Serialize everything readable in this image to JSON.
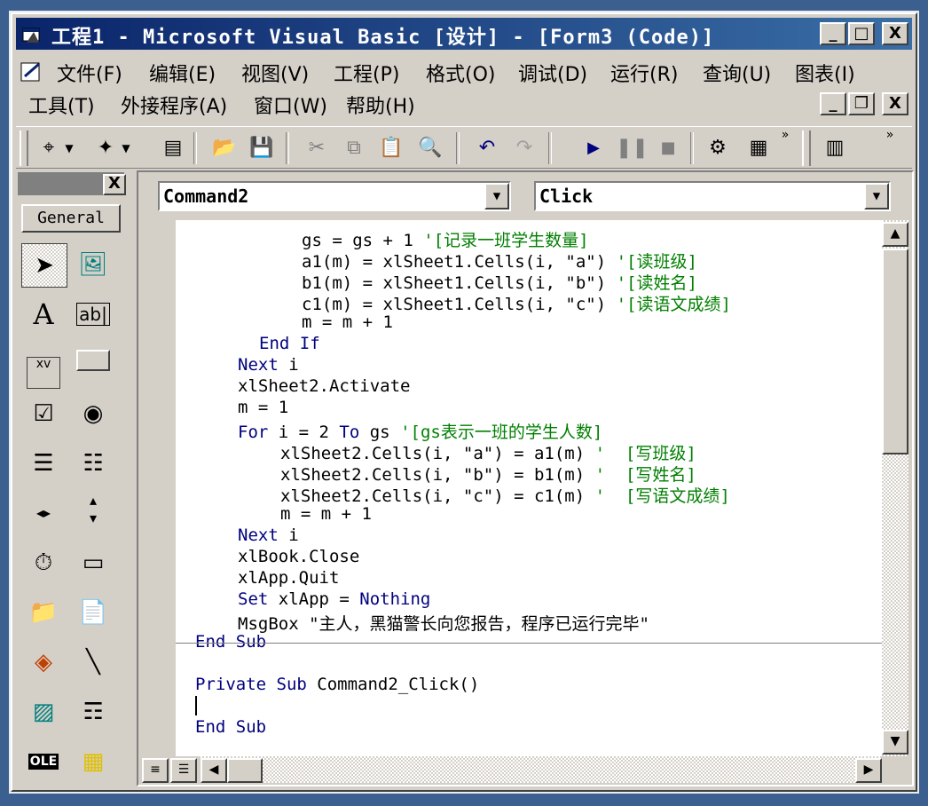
{
  "window": {
    "title": "工程1 - Microsoft Visual Basic [设计] - [Form3 (Code)]"
  },
  "window_buttons": {
    "minimize": "_",
    "maximize": "□",
    "close": "X"
  },
  "menu": [
    {
      "label": "文件(F)"
    },
    {
      "label": "编辑(E)"
    },
    {
      "label": "视图(V)"
    },
    {
      "label": "工程(P)"
    },
    {
      "label": "格式(O)"
    },
    {
      "label": "调试(D)"
    },
    {
      "label": "运行(R)"
    },
    {
      "label": "查询(U)"
    },
    {
      "label": "图表(I)"
    },
    {
      "label": "工具(T)"
    },
    {
      "label": "外接程序(A)"
    },
    {
      "label": "窗口(W)"
    },
    {
      "label": "帮助(H)"
    }
  ],
  "toolbox": {
    "tab_label": "General",
    "close": "X"
  },
  "code_window": {
    "object_combo": "Command2",
    "procedure_combo": "Click"
  },
  "code_lines": [
    {
      "text": "gs = gs + 1",
      "comment": "'[记录一班学生数量]"
    },
    {
      "text": "a1(m) = xlSheet1.Cells(i, \"a\")",
      "comment": "'[读班级]"
    },
    {
      "text": "b1(m) = xlSheet1.Cells(i, \"b\")",
      "comment": "'[读姓名]"
    },
    {
      "text": "c1(m) = xlSheet1.Cells(i, \"c\")",
      "comment": "'[读语文成绩]"
    },
    {
      "text": "m = m + 1",
      "comment": ""
    },
    {
      "kw": "End If"
    },
    {
      "kw": "Next",
      "text": " i"
    },
    {
      "text": "xlSheet2.Activate"
    },
    {
      "text": "m = 1"
    },
    {
      "kw": "For",
      "text": " i = 2 ",
      "kw2": "To",
      "text2": " gs ",
      "comment": "'[gs表示一班的学生人数]"
    },
    {
      "text": "xlSheet2.Cells(i, \"a\") = a1(m)",
      "comment": "'  [写班级]"
    },
    {
      "text": "xlSheet2.Cells(i, \"b\") = b1(m)",
      "comment": "'  [写姓名]"
    },
    {
      "text": "xlSheet2.Cells(i, \"c\") = c1(m)",
      "comment": "'  [写语文成绩]"
    },
    {
      "text": "m = m + 1"
    },
    {
      "kw": "Next",
      "text": " i"
    },
    {
      "text": "xlBook.Close"
    },
    {
      "text": "xlApp.Quit"
    },
    {
      "kw": "Set",
      "text": " xlApp = ",
      "kw2": "Nothing"
    },
    {
      "text": "MsgBox \"主人，黑猫警长向您报告，程序已运行完毕\""
    },
    {
      "kw": "End Sub"
    },
    {
      "kw": "Private Sub",
      "text": " Command2_Click()"
    },
    {
      "kw": "End Sub"
    }
  ],
  "colors": {
    "keyword": "#00007f",
    "comment": "#007f00",
    "titlebar": "#0a246a"
  }
}
